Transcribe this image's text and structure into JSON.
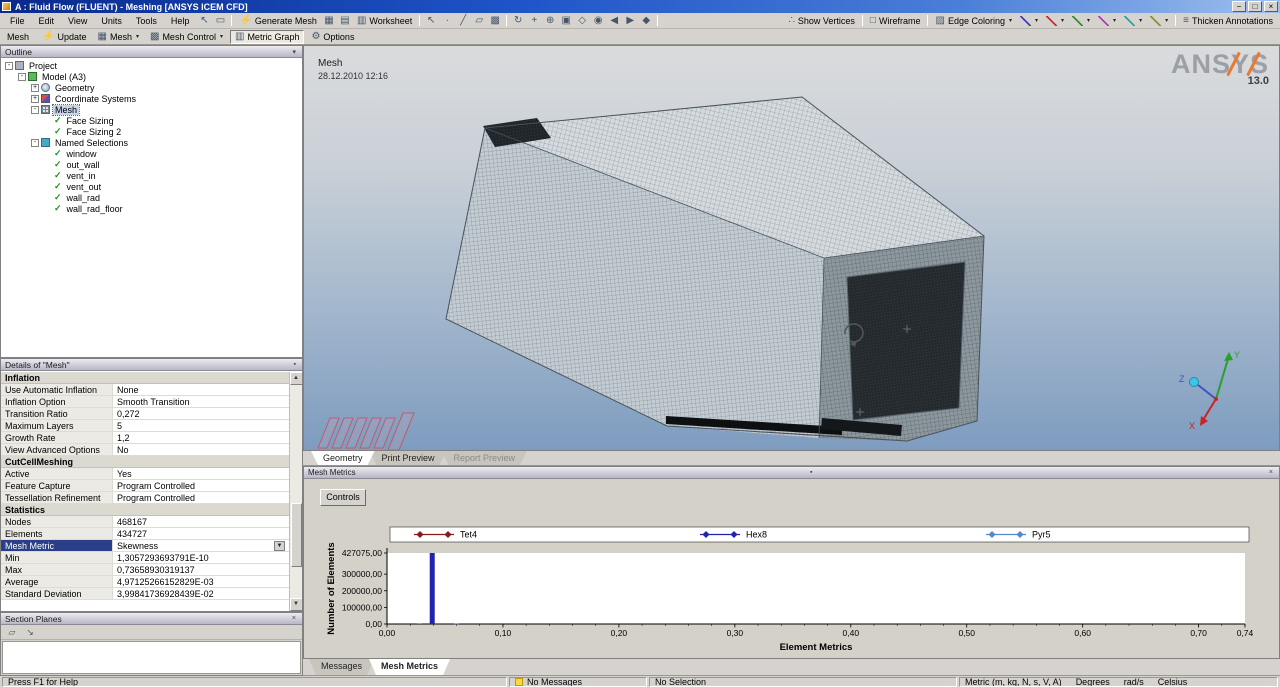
{
  "window": {
    "title": "A : Fluid Flow (FLUENT) - Meshing [ANSYS ICEM CFD]"
  },
  "menubar": {
    "menus": [
      "File",
      "Edit",
      "View",
      "Units",
      "Tools",
      "Help"
    ]
  },
  "toolbar_main": {
    "items": [
      {
        "type": "icon",
        "name": "select-mode-icon",
        "glyph": "↖"
      },
      {
        "type": "icon",
        "name": "box-select-icon",
        "glyph": "▭"
      },
      {
        "type": "sep"
      },
      {
        "type": "button",
        "name": "generate-mesh-button",
        "glyph": "⚡",
        "accent": true,
        "label": "Generate Mesh"
      },
      {
        "type": "icon",
        "name": "mesh-grid-icon",
        "glyph": "▦"
      },
      {
        "type": "icon",
        "name": "tags-icon",
        "glyph": "▤"
      },
      {
        "type": "button",
        "name": "worksheet-button",
        "glyph": "▥",
        "label": "Worksheet"
      },
      {
        "type": "sep"
      },
      {
        "type": "icon",
        "name": "cursor-icon",
        "glyph": "↖"
      },
      {
        "type": "icon",
        "name": "vertex-select-icon",
        "glyph": "∙"
      },
      {
        "type": "icon",
        "name": "edge-select-icon",
        "glyph": "╱"
      },
      {
        "type": "icon",
        "name": "face-select-icon",
        "glyph": "▱"
      },
      {
        "type": "icon",
        "name": "body-select-icon",
        "glyph": "▩"
      },
      {
        "type": "sep"
      },
      {
        "type": "icon",
        "name": "rotate-view-icon",
        "glyph": "↻"
      },
      {
        "type": "icon",
        "name": "pan-icon",
        "glyph": "+"
      },
      {
        "type": "icon",
        "name": "zoom-icon",
        "glyph": "⊕"
      },
      {
        "type": "icon",
        "name": "zoom-box-icon",
        "glyph": "▣"
      },
      {
        "type": "icon",
        "name": "fit-view-icon",
        "glyph": "◇"
      },
      {
        "type": "icon",
        "name": "magnifier-icon",
        "glyph": "◉"
      },
      {
        "type": "icon",
        "name": "prev-view-icon",
        "glyph": "◀"
      },
      {
        "type": "icon",
        "name": "next-view-icon",
        "glyph": "▶"
      },
      {
        "type": "icon",
        "name": "iso-view-icon",
        "glyph": "◆"
      },
      {
        "type": "sep"
      }
    ],
    "right_items": [
      {
        "type": "toggle",
        "name": "show-vertices-button",
        "glyph": "∴",
        "label": "Show Vertices"
      },
      {
        "type": "sep"
      },
      {
        "type": "toggle",
        "name": "wireframe-button",
        "glyph": "□",
        "label": "Wireframe"
      },
      {
        "type": "sep"
      },
      {
        "type": "dropdown",
        "name": "edge-coloring-dropdown",
        "glyph": "▨",
        "label": "Edge Coloring",
        "caret": true
      },
      {
        "type": "edge",
        "name": "edge-style-blue-dropdown",
        "color": "#4040c0"
      },
      {
        "type": "edge",
        "name": "edge-style-red-dropdown",
        "color": "#c03030"
      },
      {
        "type": "edge",
        "name": "edge-style-green-dropdown",
        "color": "#309030"
      },
      {
        "type": "edge",
        "name": "edge-style-magenta-dropdown",
        "color": "#b040b0"
      },
      {
        "type": "edge",
        "name": "edge-style-cyan-dropdown",
        "color": "#30a0a0"
      },
      {
        "type": "edge",
        "name": "edge-style-olive-dropdown",
        "color": "#909030"
      },
      {
        "type": "sep"
      },
      {
        "type": "toggle",
        "name": "thicken-annotations-button",
        "glyph": "≡",
        "label": "Thicken Annotations"
      }
    ]
  },
  "toolbar_context": {
    "items": [
      {
        "type": "label",
        "name": "context-label",
        "label": "Mesh"
      },
      {
        "type": "button",
        "name": "update-button",
        "glyph": "⚡",
        "accent": true,
        "label": "Update"
      },
      {
        "type": "dropdown",
        "name": "mesh-dropdown",
        "glyph": "▦",
        "label": "Mesh",
        "caret": true
      },
      {
        "type": "dropdown",
        "name": "mesh-control-dropdown",
        "glyph": "▩",
        "label": "Mesh Control",
        "caret": true
      },
      {
        "type": "toggle",
        "name": "metric-graph-button",
        "glyph": "▥",
        "label": "Metric Graph",
        "pressed": true
      },
      {
        "type": "button",
        "name": "options-button",
        "glyph": "⚙",
        "label": "Options"
      }
    ]
  },
  "outline": {
    "header": "Outline",
    "tree": [
      {
        "label": "Project",
        "level": 0,
        "expander": "-",
        "icon": "project"
      },
      {
        "label": "Model (A3)",
        "level": 1,
        "expander": "-",
        "icon": "model"
      },
      {
        "label": "Geometry",
        "level": 2,
        "expander": "+",
        "icon": "geometry"
      },
      {
        "label": "Coordinate Systems",
        "level": 2,
        "expander": "+",
        "icon": "csys"
      },
      {
        "label": "Mesh",
        "level": 2,
        "expander": "-",
        "icon": "mesh",
        "selected": true
      },
      {
        "label": "Face Sizing",
        "level": 3,
        "icon": "check"
      },
      {
        "label": "Face Sizing 2",
        "level": 3,
        "icon": "check"
      },
      {
        "label": "Named Selections",
        "level": 2,
        "expander": "-",
        "icon": "ns"
      },
      {
        "label": "window",
        "level": 3,
        "icon": "check"
      },
      {
        "label": "out_wall",
        "level": 3,
        "icon": "check"
      },
      {
        "label": "vent_in",
        "level": 3,
        "icon": "check"
      },
      {
        "label": "vent_out",
        "level": 3,
        "icon": "check"
      },
      {
        "label": "wall_rad",
        "level": 3,
        "icon": "check"
      },
      {
        "label": "wall_rad_floor",
        "level": 3,
        "icon": "check"
      }
    ]
  },
  "details": {
    "header": "Details of \"Mesh\"",
    "rows": [
      {
        "type": "section",
        "label": "Inflation"
      },
      {
        "label": "Use Automatic Inflation",
        "value": "None"
      },
      {
        "label": "Inflation Option",
        "value": "Smooth Transition"
      },
      {
        "label": "Transition Ratio",
        "value": "0,272"
      },
      {
        "label": "Maximum Layers",
        "value": "5"
      },
      {
        "label": "Growth Rate",
        "value": "1,2"
      },
      {
        "label": "View Advanced Options",
        "value": "No"
      },
      {
        "type": "section",
        "label": "CutCellMeshing"
      },
      {
        "label": "Active",
        "value": "Yes"
      },
      {
        "label": "Feature Capture",
        "value": "Program Controlled"
      },
      {
        "label": "Tessellation Refinement",
        "value": "Program Controlled"
      },
      {
        "type": "section",
        "label": "Statistics"
      },
      {
        "label": "Nodes",
        "value": "468167"
      },
      {
        "label": "Elements",
        "value": "434727"
      },
      {
        "label": "Mesh Metric",
        "value": "Skewness",
        "selected": true,
        "dropdown": true
      },
      {
        "label": "Min",
        "value": "1,3057293693791E-10"
      },
      {
        "label": "Max",
        "value": "0,73658930319137"
      },
      {
        "label": "Average",
        "value": "4,97125266152829E-03"
      },
      {
        "label": "Standard Deviation",
        "value": "3,99841736928439E-02"
      }
    ]
  },
  "section_planes": {
    "header": "Section Planes"
  },
  "viewport": {
    "label": "Mesh",
    "timestamp": "28.12.2010 12:16",
    "brand": "ANSYS",
    "brand_version": "13.0",
    "tabs": [
      {
        "label": "Geometry",
        "state": "active"
      },
      {
        "label": "Print Preview",
        "state": "normal"
      },
      {
        "label": "Report Preview",
        "state": "disabled"
      }
    ],
    "triad": {
      "x": "X",
      "y": "Y",
      "z": "Z"
    }
  },
  "metrics_panel": {
    "header": "Mesh Metrics",
    "controls_label": "Controls",
    "tabs": [
      {
        "label": "Messages",
        "state": "normal"
      },
      {
        "label": "Mesh Metrics",
        "state": "active"
      }
    ]
  },
  "chart_data": {
    "type": "bar",
    "title": "",
    "xlabel": "Element Metrics",
    "ylabel": "Number of Elements",
    "xlim": [
      0,
      0.74
    ],
    "ylim": [
      0,
      427075
    ],
    "x_ticks": [
      "0,00",
      "0,10",
      "0,20",
      "0,30",
      "0,40",
      "0,50",
      "0,60",
      "0,70",
      "0,74"
    ],
    "x_tick_values": [
      0.0,
      0.1,
      0.2,
      0.3,
      0.4,
      0.5,
      0.6,
      0.7,
      0.74
    ],
    "y_ticks": [
      "427075,00",
      "300000,00",
      "200000,00",
      "100000,00",
      "0,00"
    ],
    "y_tick_values": [
      427075,
      300000,
      200000,
      100000,
      0
    ],
    "legend_position": "top",
    "grid": false,
    "series": [
      {
        "name": "Tet4",
        "color": "#8b1a1a",
        "points": [
          {
            "x": 0.028,
            "y": 3000
          }
        ]
      },
      {
        "name": "Hex8",
        "color": "#2222b0",
        "points": [
          {
            "x": 0.039,
            "y": 427075
          }
        ]
      },
      {
        "name": "Pyr5",
        "color": "#5588cc",
        "points": [
          {
            "x": 0.06,
            "y": 2000
          }
        ]
      }
    ]
  },
  "statusbar": {
    "help": "Press F1 for Help",
    "messages": "No Messages",
    "selection": "No Selection",
    "units": [
      "Metric (m, kg, N, s, V, A)",
      "Degrees",
      "rad/s",
      "Celsius"
    ]
  }
}
